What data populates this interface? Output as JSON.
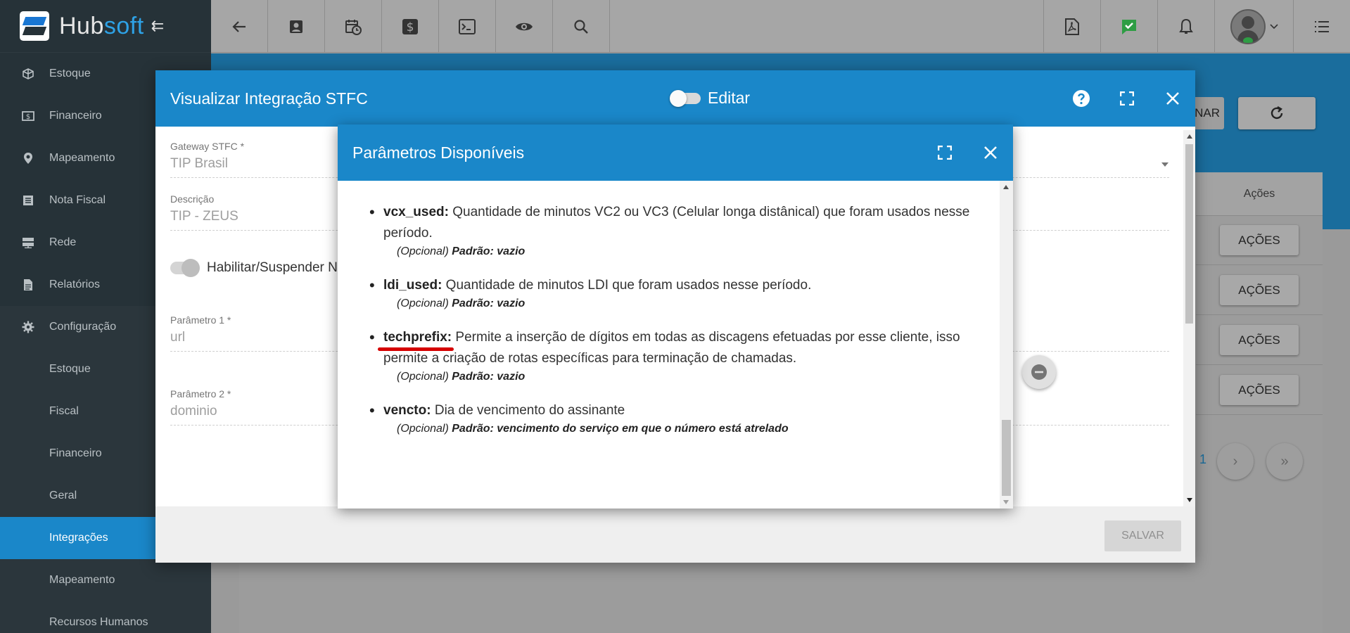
{
  "app": {
    "brand_a": "Hub",
    "brand_b": "soft",
    "collapse_glyph": "⇇"
  },
  "sidebar": {
    "items": [
      {
        "label": "Estoque",
        "icon": "box-icon"
      },
      {
        "label": "Financeiro",
        "icon": "money-icon"
      },
      {
        "label": "Mapeamento",
        "icon": "map-pin-icon"
      },
      {
        "label": "Nota Fiscal",
        "icon": "list-icon"
      },
      {
        "label": "Rede",
        "icon": "server-icon"
      },
      {
        "label": "Relatórios",
        "icon": "document-icon"
      },
      {
        "label": "Configuração",
        "icon": "gear-icon"
      }
    ],
    "subitems": [
      {
        "label": "Estoque"
      },
      {
        "label": "Fiscal"
      },
      {
        "label": "Financeiro"
      },
      {
        "label": "Geral"
      },
      {
        "label": "Integrações",
        "active": true
      },
      {
        "label": "Mapeamento"
      },
      {
        "label": "Recursos Humanos"
      }
    ]
  },
  "background": {
    "nar_label": "NAR",
    "acoes_header": "Ações",
    "acoes_button": "AÇÕES",
    "page_fragment": ": 1",
    "pager_next": "›",
    "pager_last": "»"
  },
  "modal": {
    "title": "Visualizar Integração STFC",
    "edit_toggle_label": "Editar",
    "fields": {
      "gateway_label": "Gateway STFC *",
      "gateway_value": "TIP Brasil",
      "descricao_label": "Descrição",
      "descricao_value": "TIP - ZEUS",
      "switch_label": "Habilitar/Suspender N",
      "param1_label": "Parâmetro 1 *",
      "param1_value": "url",
      "param2_label": "Parâmetro 2 *",
      "param2_value": "dominio"
    },
    "save_label": "SALVAR"
  },
  "inner_modal": {
    "title": "Parâmetros Disponíveis",
    "params": [
      {
        "key": "vcx_used:",
        "desc": " Quantidade de minutos VC2 ou VC3 (Celular longa distânical) que foram usados nesse período.",
        "opt": "(Opcional) ",
        "default": "Padrão: vazio"
      },
      {
        "key": "ldi_used:",
        "desc": " Quantidade de minutos LDI que foram usados nesse período.",
        "opt": "(Opcional) ",
        "default": "Padrão: vazio"
      },
      {
        "key": "techprefix:",
        "desc": " Permite a inserção de dígitos em todas as discagens efetuadas por esse cliente, isso permite a criação de rotas específicas para terminação de chamadas.",
        "opt": "(Opcional) ",
        "default": "Padrão: vazio"
      },
      {
        "key": "vencto:",
        "desc": " Dia de vencimento do assinante",
        "opt": "(Opcional) ",
        "default": "Padrão: vencimento do serviço em que o número está atrelado"
      }
    ]
  },
  "colors": {
    "accent": "#1a87c9",
    "sidebar": "#263238",
    "annotation": "#d50000"
  }
}
